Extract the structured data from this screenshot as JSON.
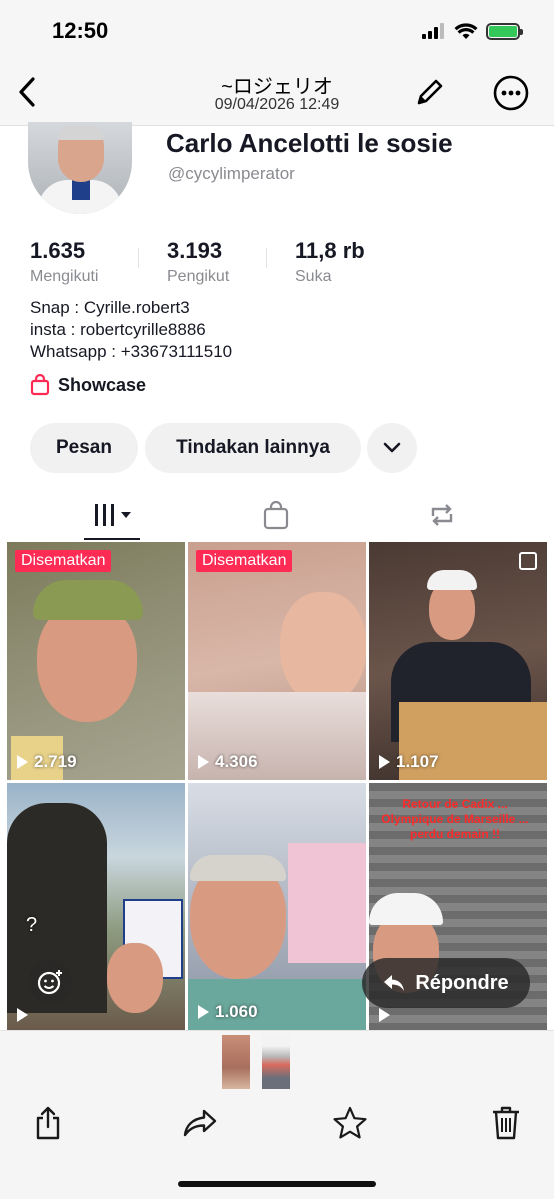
{
  "status_bar": {
    "time": "12:50",
    "battery_color": "#34c759"
  },
  "header": {
    "title": "~ロジェリオ",
    "date": "09/04/2026 12:49",
    "icons": [
      "back-chevron-icon",
      "pencil-icon",
      "more-icon"
    ]
  },
  "profile": {
    "name": "Carlo Ancelotti le sosie",
    "handle": "@cycylimperator",
    "stats": [
      {
        "value": "1.635",
        "label": "Mengikuti"
      },
      {
        "value": "3.193",
        "label": "Pengikut"
      },
      {
        "value": "11,8 rb",
        "label": "Suka"
      }
    ],
    "bio_lines": [
      "Snap : Cyrille.robert3",
      "insta : robertcyrille8886",
      "Whatsapp : +33673111510"
    ],
    "showcase_label": "Showcase",
    "buttons": {
      "message": "Pesan",
      "more_actions": "Tindakan lainnya"
    }
  },
  "tabs": {
    "icons": [
      "grid-icon",
      "shopping-bag-icon",
      "repost-icon"
    ]
  },
  "videos": [
    {
      "pinned": "Disematkan",
      "views": "2.719"
    },
    {
      "pinned": "Disematkan",
      "views": "4.306"
    },
    {
      "views": "1.107"
    },
    {
      "views": ""
    },
    {
      "views": "1.060"
    },
    {
      "views": "",
      "overlay_text": "Retour de Cadix ... Olympique de Marseille ... perdu demain !!"
    }
  ],
  "overlay": {
    "reply_label": "Répondre",
    "question_mark": "?"
  },
  "colors": {
    "accent": "#fe2c55",
    "text": "#161823",
    "muted": "#8a8b91"
  },
  "toolbar": {
    "icons": [
      "share-icon",
      "forward-icon",
      "star-icon",
      "trash-icon"
    ]
  }
}
